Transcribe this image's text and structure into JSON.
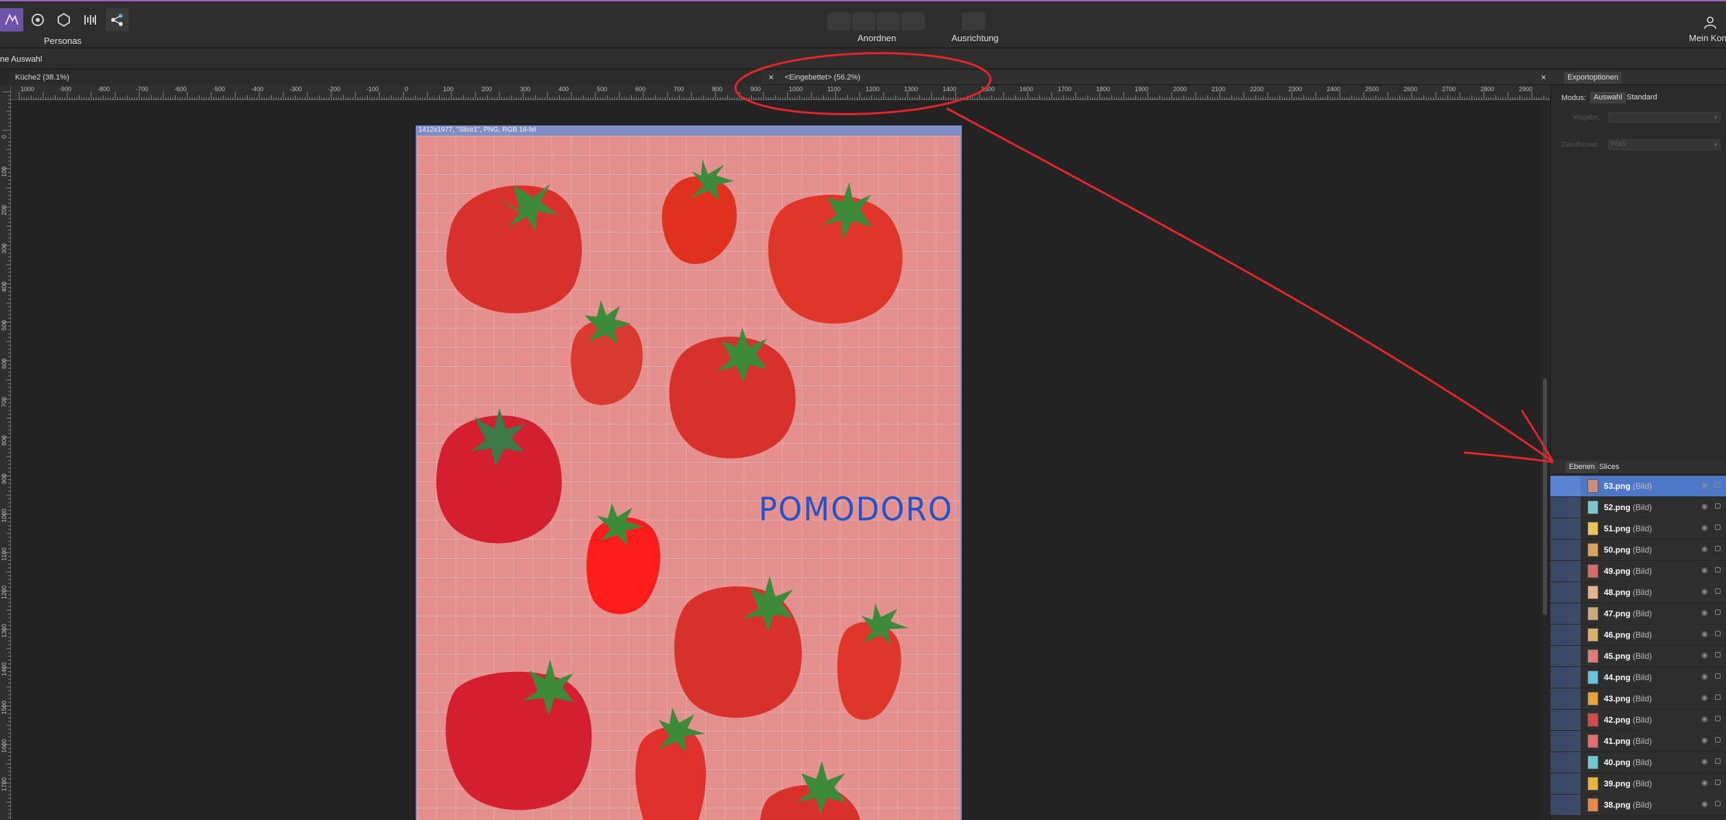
{
  "toolbar": {
    "personas_label": "Personas",
    "arrange_label": "Anordnen",
    "align_label": "Ausrichtung",
    "account_label": "Mein Kon"
  },
  "context_bar": {
    "selection_text": "ne Auswahl"
  },
  "tabs": [
    {
      "label": "Küche2 (38.1%)"
    },
    {
      "label": "<Eingebettet> (56.2%)"
    }
  ],
  "ruler_h_ticks": [
    "1000",
    "-900",
    "-800",
    "-700",
    "-600",
    "-500",
    "-400",
    "-300",
    "-200",
    "-100",
    "0",
    "100",
    "200",
    "300",
    "400",
    "500",
    "600",
    "700",
    "800",
    "900",
    "1000",
    "1100",
    "1200",
    "1300",
    "1400",
    "1500",
    "1600",
    "1700",
    "1800",
    "1900",
    "2000",
    "2100",
    "2200",
    "2300",
    "2400",
    "2500",
    "2600",
    "2700",
    "2800",
    "2900"
  ],
  "ruler_v_ticks": [
    "0",
    "100",
    "200",
    "300",
    "400",
    "500",
    "600",
    "700",
    "800",
    "900",
    "1000",
    "1100",
    "1200",
    "1300",
    "1400",
    "1500",
    "1600",
    "1700"
  ],
  "artboard": {
    "slice_info": "1412x1977, \"Slice1\", PNG, RGB 16-bit",
    "text": "POMODORO"
  },
  "export_panel": {
    "tab": "Exportoptionen",
    "mode_label": "Modus:",
    "mode_selection": "Auswahl",
    "mode_standard": "Standard",
    "preset_label": "Vorgabe:",
    "format_label": "Dateiformat:",
    "format_value": "PNG"
  },
  "layers_panel": {
    "tab_layers": "Ebenen",
    "tab_slices": "Slices",
    "type_suffix": "(Bild)",
    "items": [
      {
        "name": "53.png",
        "selected": true,
        "thumb": "#c98f7a"
      },
      {
        "name": "52.png",
        "thumb": "#7cc5cf"
      },
      {
        "name": "51.png",
        "thumb": "#e9c45a"
      },
      {
        "name": "50.png",
        "thumb": "#d9a15b"
      },
      {
        "name": "49.png",
        "thumb": "#d96a6a"
      },
      {
        "name": "48.png",
        "thumb": "#e2b48a"
      },
      {
        "name": "47.png",
        "thumb": "#c9a87a"
      },
      {
        "name": "46.png",
        "thumb": "#d9b06b"
      },
      {
        "name": "45.png",
        "thumb": "#e07b7b"
      },
      {
        "name": "44.png",
        "thumb": "#6cc3d9"
      },
      {
        "name": "43.png",
        "thumb": "#e8a23a"
      },
      {
        "name": "42.png",
        "thumb": "#d44a4a"
      },
      {
        "name": "41.png",
        "thumb": "#e26f6f"
      },
      {
        "name": "40.png",
        "thumb": "#6fc7d2"
      },
      {
        "name": "39.png",
        "thumb": "#e9b23b"
      },
      {
        "name": "38.png",
        "thumb": "#e58a4a"
      }
    ]
  },
  "colors": {
    "accent": "#a45fc4",
    "selection": "#4d78c8",
    "annotation": "#e8242a"
  }
}
